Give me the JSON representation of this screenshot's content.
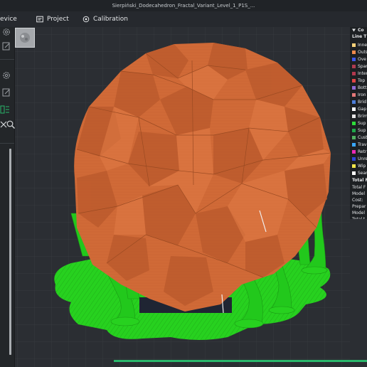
{
  "window": {
    "title": "Sierpiński_Dodecahedron_Fractal_Variant_Level_1_P1S_..."
  },
  "menubar": {
    "device_label": "evice",
    "project_label": "Project",
    "calibration_label": "Calibration"
  },
  "legend": {
    "title": "Co",
    "subtitle": "Line T",
    "items": [
      {
        "label": "Inne",
        "color": "#f7d27a"
      },
      {
        "label": "Outs",
        "color": "#f08a4b"
      },
      {
        "label": "Ove",
        "color": "#3d56e8"
      },
      {
        "label": "Spar",
        "color": "#ad3c4f"
      },
      {
        "label": "Inter",
        "color": "#b2384e"
      },
      {
        "label": "Top",
        "color": "#e24444"
      },
      {
        "label": "Bott",
        "color": "#8e6ad6"
      },
      {
        "label": "Iron",
        "color": "#e47878"
      },
      {
        "label": "Brid",
        "color": "#4d7ed8"
      },
      {
        "label": "Gap",
        "color": "#ffffff"
      },
      {
        "label": "Brim",
        "color": "#e6e6e6"
      },
      {
        "label": "Sup",
        "color": "#2edc3a"
      },
      {
        "label": "Sup",
        "color": "#1fa84a"
      },
      {
        "label": "Cust",
        "color": "#50b060"
      },
      {
        "label": "Trav",
        "color": "#3aa7ff"
      },
      {
        "label": "Retr",
        "color": "#ec2ab5"
      },
      {
        "label": "Unre",
        "color": "#2e45d8"
      },
      {
        "label": "Wip",
        "color": "#f3e64a"
      },
      {
        "label": "Sear",
        "color": "#ffffff"
      }
    ],
    "stats_title": "Total F",
    "stats": [
      "Total F",
      "Model",
      "Cost:",
      "Prepar",
      "Model",
      "Total t"
    ]
  },
  "colors": {
    "model_orange": "#d06a37",
    "support_green": "#27d11f",
    "bed_dark": "#2b2e33",
    "accent_green": "#2ab86c"
  }
}
